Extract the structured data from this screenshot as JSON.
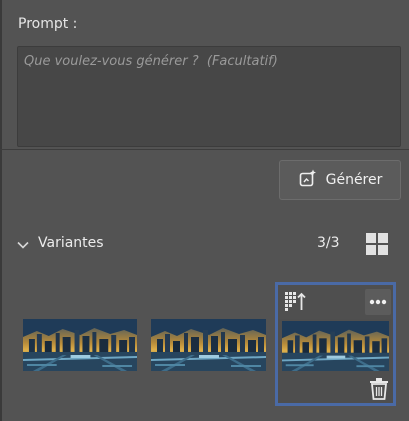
{
  "prompt": {
    "label": "Prompt :",
    "placeholder": "Que voulez-vous générer ?  (Facultatif)",
    "value": ""
  },
  "generate_button": {
    "label": "Générer",
    "icon": "generate-sparkle-icon"
  },
  "variants": {
    "label": "Variantes",
    "count": "3/3",
    "expanded": true,
    "items": [
      {
        "thumbnail": "futuristic-city-skyline",
        "selected": false
      },
      {
        "thumbnail": "futuristic-city-skyline",
        "selected": false
      },
      {
        "thumbnail": "futuristic-city-skyline",
        "selected": true
      }
    ]
  },
  "colors": {
    "panel_background": "#535353",
    "field_background": "#474747",
    "selection_border": "#4a6aa6",
    "text": "#e8e8e8",
    "placeholder": "#9e9e9e"
  }
}
